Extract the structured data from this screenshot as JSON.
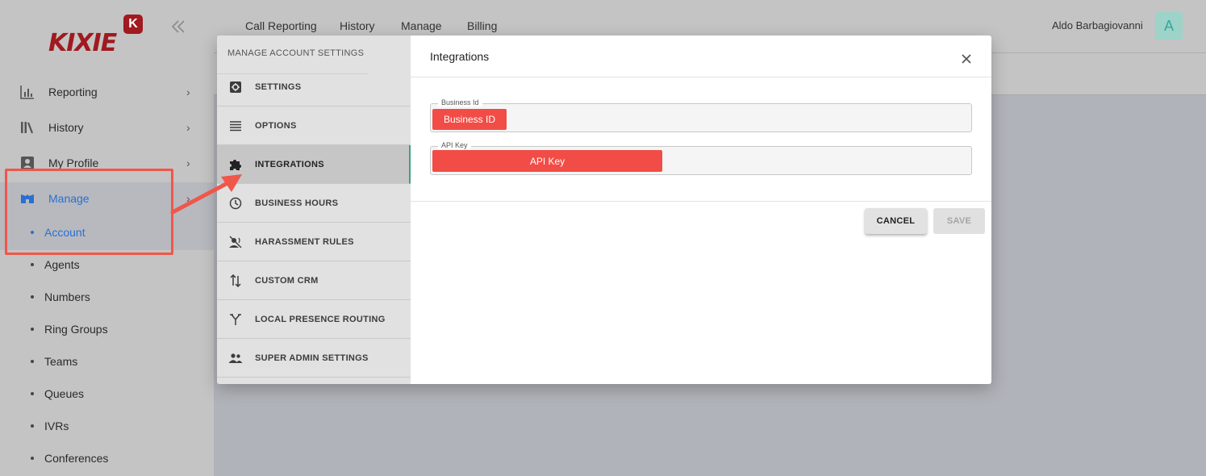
{
  "app": {
    "logo_text": "KIXIE",
    "logo_badge": "K",
    "brand_color": "#a01a20"
  },
  "sidebar": {
    "collapse_icon": "double-chevron-left-icon",
    "items": [
      {
        "label": "Reporting",
        "icon": "bar-chart-icon"
      },
      {
        "label": "History",
        "icon": "books-icon"
      },
      {
        "label": "My Profile",
        "icon": "id-card-icon"
      },
      {
        "label": "Manage",
        "icon": "manage-icon",
        "active": true
      }
    ],
    "subitems": [
      "Account",
      "Agents",
      "Numbers",
      "Ring Groups",
      "Teams",
      "Queues",
      "IVRs",
      "Conferences"
    ],
    "active_subitem": "Account"
  },
  "topnav": {
    "items": [
      "Call Reporting",
      "History",
      "Manage",
      "Billing"
    ]
  },
  "user": {
    "name": "Aldo Barbagiovanni",
    "initial": "A"
  },
  "modal": {
    "menu_title": "MANAGE ACCOUNT SETTINGS",
    "menu": [
      {
        "label": "SETTINGS",
        "icon": "gear-icon"
      },
      {
        "label": "OPTIONS",
        "icon": "list-icon"
      },
      {
        "label": "INTEGRATIONS",
        "icon": "puzzle-icon",
        "active": true
      },
      {
        "label": "BUSINESS HOURS",
        "icon": "clock-icon"
      },
      {
        "label": "HARASSMENT RULES",
        "icon": "voice-off-icon"
      },
      {
        "label": "CUSTOM CRM",
        "icon": "swap-vertical-icon"
      },
      {
        "label": "LOCAL PRESENCE ROUTING",
        "icon": "fork-icon"
      },
      {
        "label": "SUPER ADMIN SETTINGS",
        "icon": "people-icon"
      }
    ],
    "title": "Integrations",
    "fields": {
      "business_id": {
        "label": "Business Id",
        "redacted_value": "Business ID"
      },
      "api_key": {
        "label": "API Key",
        "redacted_value": "API Key"
      }
    },
    "buttons": {
      "cancel": "CANCEL",
      "save": "SAVE"
    }
  },
  "annotation": {
    "color": "#f0564a"
  }
}
